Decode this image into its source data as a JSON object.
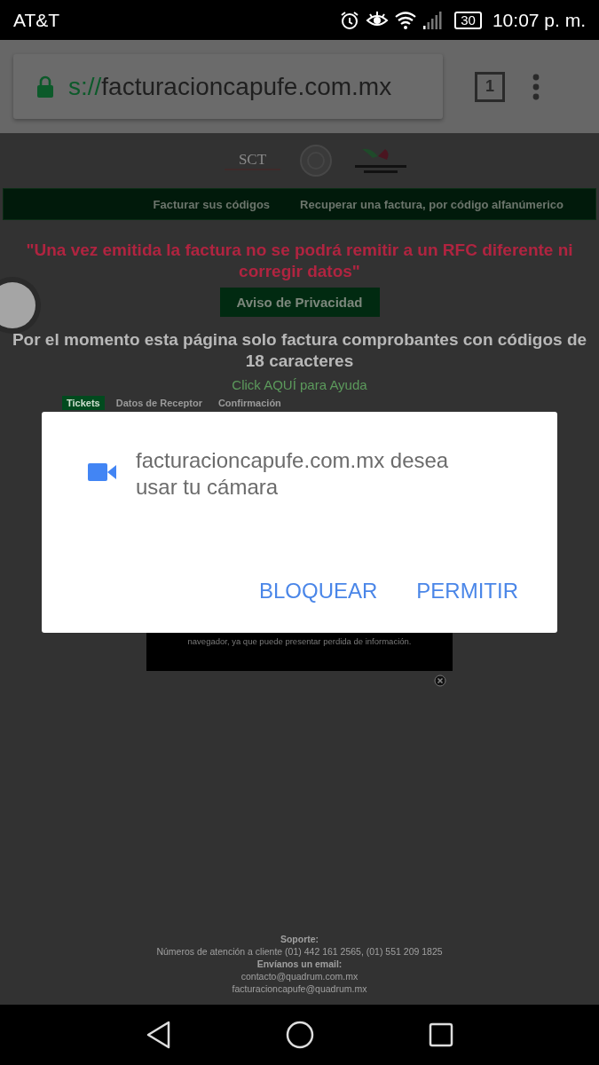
{
  "status_bar": {
    "carrier": "AT&T",
    "battery": "30",
    "time": "10:07 p. m."
  },
  "browser": {
    "url_scheme": "s://",
    "url_host": "facturacioncapufe.com.mx",
    "tab_count": "1"
  },
  "page": {
    "logo_text": "SCT",
    "nav": [
      {
        "label": "Facturar sus códigos"
      },
      {
        "label": "Recuperar una factura, por código alfanúmerico"
      }
    ],
    "warning": "\"Una vez emitida la factura no se podrá remitir a un RFC diferente ni corregir datos\"",
    "privacy_button": "Aviso de Privacidad",
    "notice": "Por el momento esta página solo factura comprobantes con códigos de 18 caracteres",
    "help_link": "Click AQUÍ para Ayuda",
    "steps": [
      {
        "label": "Tickets",
        "selected": true
      },
      {
        "label": "Datos de Receptor",
        "selected": false
      },
      {
        "label": "Confirmación",
        "selected": false
      }
    ],
    "popup_text": "navegador, ya que puede presentar perdida de información.",
    "footer": [
      {
        "text": "Soporte:",
        "bold": true
      },
      {
        "text": "Números de atención a cliente (01) 442 161 2565, (01) 551 209 1825",
        "bold": false
      },
      {
        "text": "Envíanos un email:",
        "bold": true
      },
      {
        "text": "contacto@quadrum.com.mx",
        "bold": false
      },
      {
        "text": "facturacioncapufe@quadrum.mx",
        "bold": false
      }
    ]
  },
  "dialog": {
    "message": "facturacioncapufe.com.mx desea usar tu cámara",
    "buttons": [
      "BLOQUEAR",
      "PERMITIR"
    ]
  }
}
